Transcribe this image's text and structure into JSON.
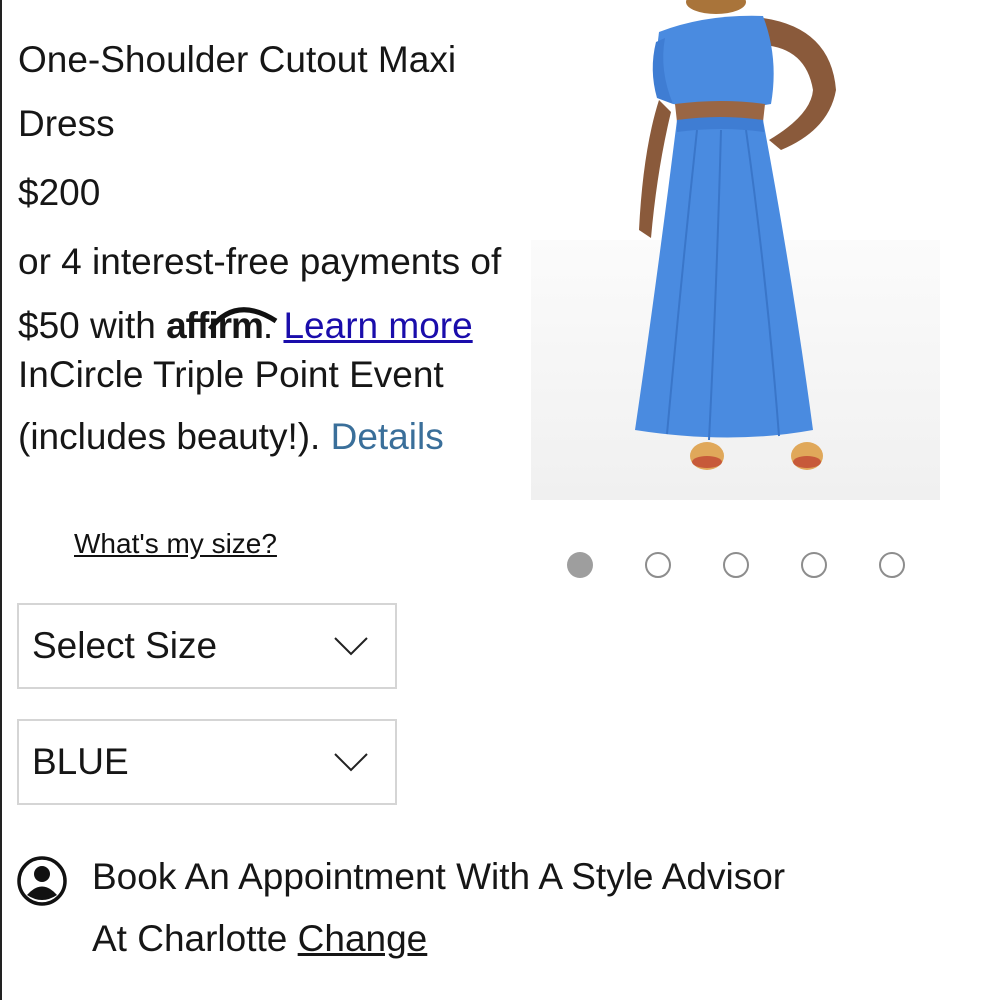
{
  "product": {
    "title": "One-Shoulder Cutout Maxi Dress",
    "price": "$200"
  },
  "affirm": {
    "text_before": "or 4 interest-free payments of $50 with",
    "logo_text": "affirm",
    "period": ".",
    "learn_more": "Learn more"
  },
  "promo": {
    "text": "InCircle Triple Point Event (includes beauty!).",
    "details_link": "Details"
  },
  "size_help_link": "What's my size?",
  "selects": {
    "size": "Select Size",
    "color": "BLUE"
  },
  "gallery": {
    "total_images": 5,
    "active_index": 0
  },
  "appointment": {
    "line1": "Book An Appointment With A Style Advisor",
    "line2_prefix": "At Charlotte",
    "change_link": "Change"
  },
  "colors": {
    "dress_blue": "#4a8be0",
    "link_blue": "#1a0dab",
    "details_blue": "#3a6f9a",
    "border_gray": "#d5d5d5"
  },
  "icons": {
    "select_chevron": "chevron-down-icon",
    "appointment": "user-circle-icon"
  }
}
